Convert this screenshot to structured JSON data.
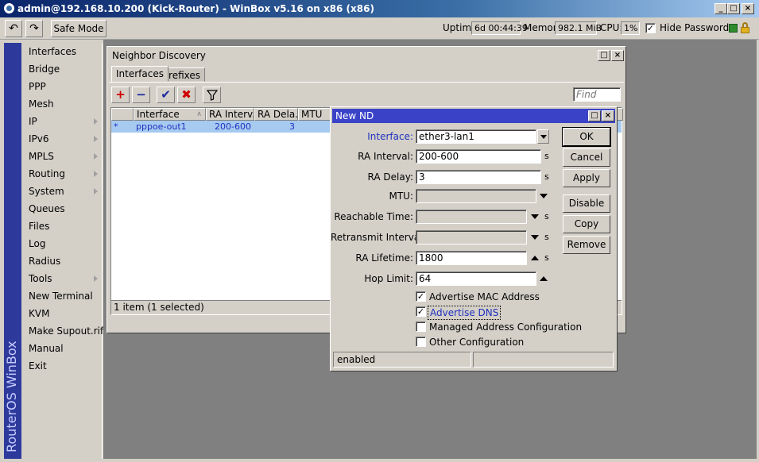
{
  "window": {
    "title": "admin@192.168.10.200 (Kick-Router) - WinBox v5.16 on x86 (x86)",
    "minimize": "_",
    "maximize": "□",
    "close": "×"
  },
  "toolbar": {
    "undo_icon": "↶",
    "redo_icon": "↷",
    "safe_mode": "Safe Mode",
    "uptime_label": "Uptime:",
    "uptime_value": "6d 00:44:39",
    "memory_label": "Memory:",
    "memory_value": "982.1 MiB",
    "cpu_label": "CPU:",
    "cpu_value": "1%",
    "hide_passwords_label": "Hide Passwords",
    "hide_passwords_checked": "✓",
    "status_color": "#2e8b2e",
    "lock_color": "#e0b020"
  },
  "brand": "RouterOS WinBox",
  "sidebar": {
    "items": [
      {
        "label": "Interfaces",
        "submenu": false
      },
      {
        "label": "Bridge",
        "submenu": false
      },
      {
        "label": "PPP",
        "submenu": false
      },
      {
        "label": "Mesh",
        "submenu": false
      },
      {
        "label": "IP",
        "submenu": true
      },
      {
        "label": "IPv6",
        "submenu": true
      },
      {
        "label": "MPLS",
        "submenu": true
      },
      {
        "label": "Routing",
        "submenu": true
      },
      {
        "label": "System",
        "submenu": true
      },
      {
        "label": "Queues",
        "submenu": false
      },
      {
        "label": "Files",
        "submenu": false
      },
      {
        "label": "Log",
        "submenu": false
      },
      {
        "label": "Radius",
        "submenu": false
      },
      {
        "label": "Tools",
        "submenu": true
      },
      {
        "label": "New Terminal",
        "submenu": false
      },
      {
        "label": "KVM",
        "submenu": false
      },
      {
        "label": "Make Supout.rif",
        "submenu": false
      },
      {
        "label": "Manual",
        "submenu": false
      },
      {
        "label": "Exit",
        "submenu": false
      }
    ]
  },
  "nd_window": {
    "title": "Neighbor Discovery",
    "tabs": [
      "Interfaces",
      "Prefixes"
    ],
    "find_placeholder": "Find",
    "columns": [
      "Interface",
      "RA Interv...",
      "RA Dela...",
      "MTU"
    ],
    "rows": [
      {
        "flag": "*",
        "interface": "pppoe-out1",
        "ra_interval": "200-600",
        "ra_delay": "3",
        "mtu": ""
      }
    ],
    "footer": "1 item (1 selected)"
  },
  "dialog": {
    "title": "New ND",
    "fields": {
      "interface": {
        "label": "Interface:",
        "value": "ether3-lan1"
      },
      "ra_interval": {
        "label": "RA Interval:",
        "value": "200-600",
        "unit": "s"
      },
      "ra_delay": {
        "label": "RA Delay:",
        "value": "3",
        "unit": "s"
      },
      "mtu": {
        "label": "MTU:",
        "value": ""
      },
      "reachable_time": {
        "label": "Reachable Time:",
        "value": "",
        "unit": "s"
      },
      "retransmit_interval": {
        "label": "Retransmit Interval:",
        "value": "",
        "unit": "s"
      },
      "ra_lifetime": {
        "label": "RA Lifetime:",
        "value": "1800",
        "unit": "s"
      },
      "hop_limit": {
        "label": "Hop Limit:",
        "value": "64"
      }
    },
    "options": [
      {
        "label": "Advertise MAC Address",
        "checked": true
      },
      {
        "label": "Advertise DNS",
        "checked": true
      },
      {
        "label": "Managed Address Configuration",
        "checked": false
      },
      {
        "label": "Other Configuration",
        "checked": false
      }
    ],
    "check_mark": "✓",
    "buttons": {
      "ok": "OK",
      "cancel": "Cancel",
      "apply": "Apply",
      "disable": "Disable",
      "copy": "Copy",
      "remove": "Remove"
    },
    "status": "enabled"
  }
}
